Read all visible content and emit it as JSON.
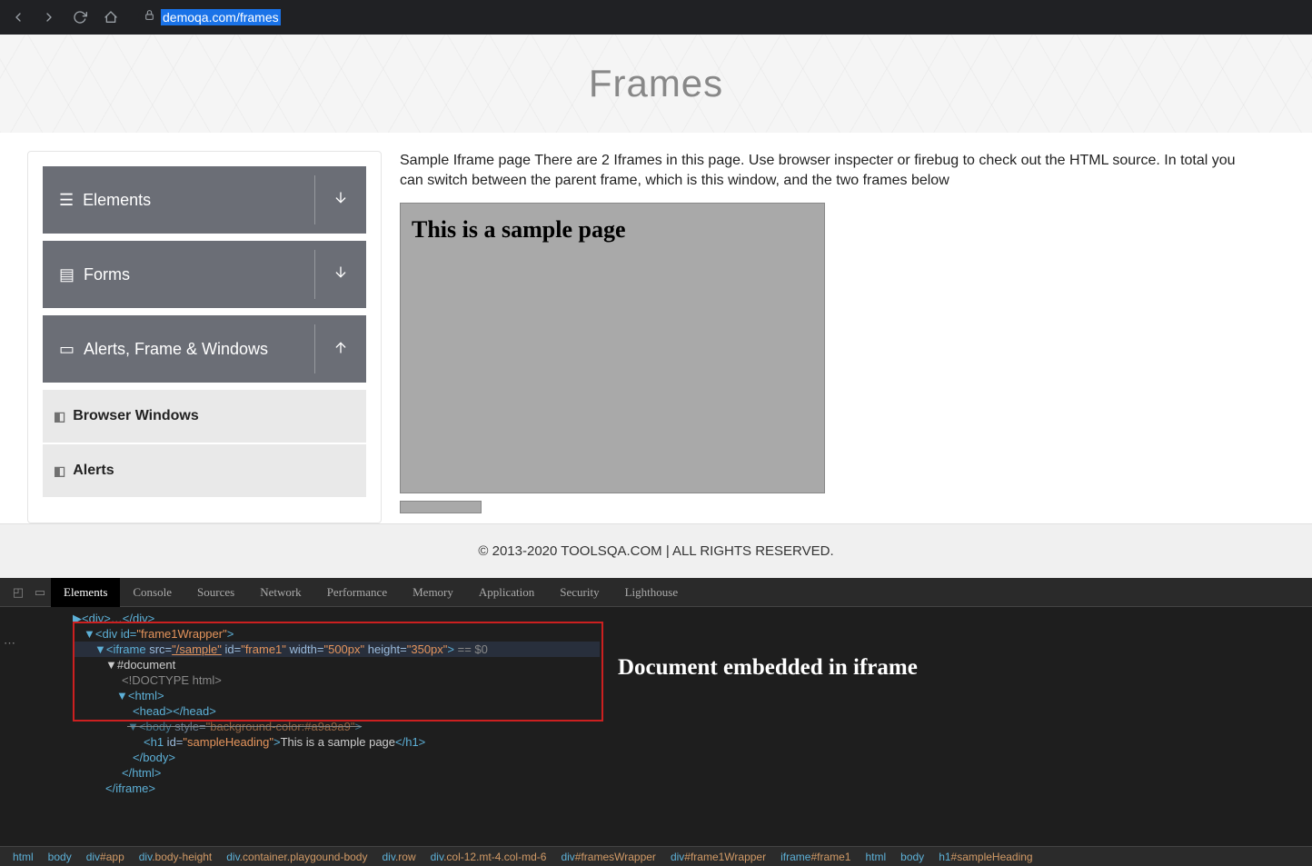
{
  "browser": {
    "url_domain": "demoqa.com",
    "url_path": "/frames"
  },
  "hero": {
    "title": "Frames"
  },
  "sidebar": {
    "groups": [
      {
        "label": "Elements",
        "direction": "down"
      },
      {
        "label": "Forms",
        "direction": "down"
      },
      {
        "label": "Alerts, Frame & Windows",
        "direction": "up"
      }
    ],
    "subs": [
      {
        "label": "Browser Windows"
      },
      {
        "label": "Alerts"
      }
    ]
  },
  "content": {
    "description": "Sample Iframe page There are 2 Iframes in this page. Use browser inspecter or firebug to check out the HTML source. In total you can switch between the parent frame, which is this window, and the two frames below",
    "frame_heading": "This is a sample page"
  },
  "footer": {
    "text": "© 2013-2020 TOOLSQA.COM | ALL RIGHTS RESERVED."
  },
  "devtools": {
    "tabs": [
      "Elements",
      "Console",
      "Sources",
      "Network",
      "Performance",
      "Memory",
      "Application",
      "Security",
      "Lighthouse"
    ],
    "active_tab": "Elements",
    "lines": {
      "l0": "▶<div>…</div>",
      "l1_open": "▼<div id=",
      "l1_id": "\"frame1Wrapper\"",
      "l1_close": ">",
      "l2_a": "▼<iframe",
      "l2_src": " src=",
      "l2_srcv": "\"/sample\"",
      "l2_id": " id=",
      "l2_idv": "\"frame1\"",
      "l2_w": " width=",
      "l2_wv": "\"500px\"",
      "l2_h": " height=",
      "l2_hv": "\"350px\"",
      "l2_end": ">",
      "l2_cmt": " == $0",
      "l3": "▼#document",
      "l4": "<!DOCTYPE html>",
      "l5": "▼<html>",
      "l6": "<head></head>",
      "l7a": "▼<body",
      "l7b": " style=",
      "l7c": "\"background-color:#a9a9a9\"",
      "l7d": ">",
      "l8a": "<h1",
      "l8b": " id=",
      "l8c": "\"sampleHeading\"",
      "l8d": ">",
      "l8txt": "This is a sample page",
      "l8e": "</h1>",
      "l9": "</body>",
      "l10": "</html>",
      "l11": "</iframe>"
    },
    "annotation": "Document embedded in iframe",
    "breadcrumbs": [
      "html",
      "body",
      "div#app",
      "div.body-height",
      "div.container.playgound-body",
      "div.row",
      "div.col-12.mt-4.col-md-6",
      "div#framesWrapper",
      "div#frame1Wrapper",
      "iframe#frame1",
      "html",
      "body",
      "h1#sampleHeading"
    ]
  }
}
